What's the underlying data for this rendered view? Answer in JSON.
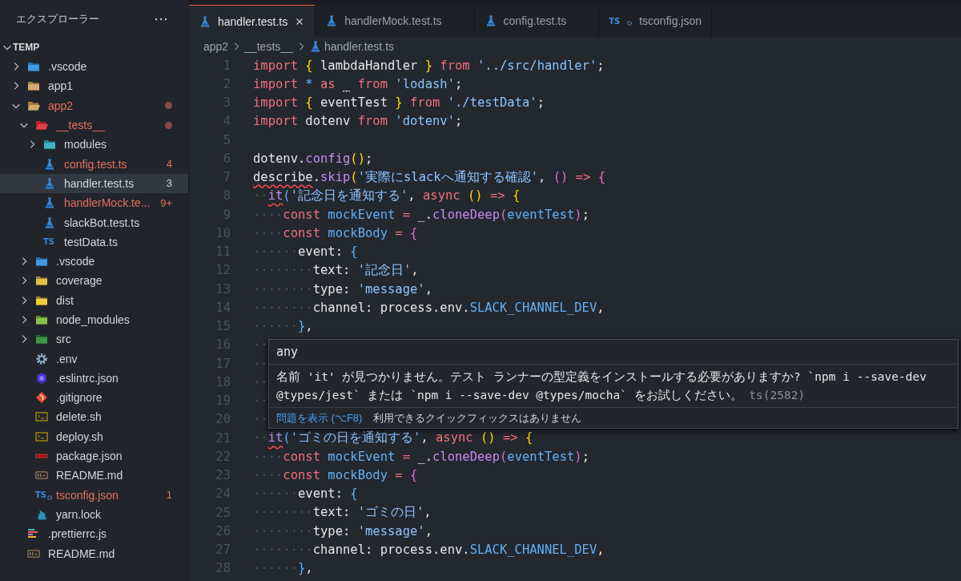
{
  "explorer": {
    "title": "エクスプローラー",
    "root": {
      "name": "TEMP",
      "expanded": true,
      "children": [
        {
          "name": ".vscode",
          "kind": "folder-vscode",
          "expanded": false,
          "error": false,
          "selected": false
        },
        {
          "name": "app1",
          "kind": "folder",
          "expanded": false,
          "error": false,
          "selected": false
        },
        {
          "name": "app2",
          "kind": "folder",
          "expanded": true,
          "error": true,
          "selected": false,
          "children": [
            {
              "name": "__tests__",
              "kind": "folder-test",
              "expanded": true,
              "error": true,
              "selected": false,
              "children": [
                {
                  "name": "modules",
                  "kind": "folder-modules",
                  "expanded": false,
                  "error": false,
                  "selected": false
                },
                {
                  "name": "config.test.ts",
                  "kind": "test-ts",
                  "error": true,
                  "badge": "4",
                  "selected": false
                },
                {
                  "name": "handler.test.ts",
                  "kind": "test-ts",
                  "error": false,
                  "badge": "3",
                  "selected": true
                },
                {
                  "name": "handlerMock.te...",
                  "kind": "test-ts",
                  "error": true,
                  "badge": "9+",
                  "selected": false
                },
                {
                  "name": "slackBot.test.ts",
                  "kind": "test-ts",
                  "error": false,
                  "selected": false
                },
                {
                  "name": "testData.ts",
                  "kind": "ts",
                  "icon_text": "TS",
                  "error": false,
                  "selected": false
                }
              ]
            },
            {
              "name": ".vscode",
              "kind": "folder-vscode",
              "expanded": false,
              "error": false,
              "selected": false
            },
            {
              "name": "coverage",
              "kind": "folder-coverage",
              "expanded": false,
              "error": false,
              "selected": false
            },
            {
              "name": "dist",
              "kind": "folder-dist",
              "expanded": false,
              "error": false,
              "selected": false
            },
            {
              "name": "node_modules",
              "kind": "folder-node",
              "expanded": false,
              "error": false,
              "selected": false
            },
            {
              "name": "src",
              "kind": "folder-src",
              "expanded": false,
              "error": false,
              "selected": false
            },
            {
              "name": ".env",
              "kind": "env",
              "error": false,
              "selected": false
            },
            {
              "name": ".eslintrc.json",
              "kind": "eslint",
              "error": false,
              "selected": false
            },
            {
              "name": ".gitignore",
              "kind": "git",
              "error": false,
              "selected": false
            },
            {
              "name": "delete.sh",
              "kind": "shell",
              "error": false,
              "selected": false
            },
            {
              "name": "deploy.sh",
              "kind": "shell",
              "error": false,
              "selected": false
            },
            {
              "name": "package.json",
              "kind": "npm",
              "error": false,
              "selected": false
            },
            {
              "name": "README.md",
              "kind": "markdown",
              "error": false,
              "selected": false
            },
            {
              "name": "tsconfig.json",
              "kind": "tsconfig",
              "icon_text": "TS",
              "error": true,
              "badge": "1",
              "selected": false
            },
            {
              "name": "yarn.lock",
              "kind": "yarn",
              "error": false,
              "selected": false
            }
          ]
        },
        {
          "name": ".prettierrc.js",
          "kind": "prettier",
          "error": false,
          "selected": false
        },
        {
          "name": "README.md",
          "kind": "markdown",
          "error": false,
          "selected": false
        }
      ]
    }
  },
  "tabs": [
    {
      "label": "handler.test.ts",
      "kind": "test-ts",
      "selected": true
    },
    {
      "label": "handlerMock.test.ts",
      "kind": "test-ts",
      "selected": false
    },
    {
      "label": "config.test.ts",
      "kind": "test-ts",
      "selected": false
    },
    {
      "label": "tsconfig.json",
      "kind": "tsconfig",
      "icon_text": "TS",
      "selected": false
    }
  ],
  "breadcrumb": [
    {
      "label": "app2",
      "kind": "folder"
    },
    {
      "label": "__tests__",
      "kind": "folder"
    },
    {
      "label": "handler.test.ts",
      "kind": "test-ts"
    }
  ],
  "code_lines": [
    {
      "number": "1",
      "tokens": [
        {
          "kind": "kw",
          "text": "import "
        },
        {
          "kind": "b1",
          "text": "{"
        },
        {
          "kind": "tx",
          "text": " lambdaHandler "
        },
        {
          "kind": "b1",
          "text": "}"
        },
        {
          "kind": "kw",
          "text": " from "
        },
        {
          "kind": "str",
          "text": "'../src/handler'"
        },
        {
          "kind": "tx",
          "text": ";"
        }
      ]
    },
    {
      "number": "2",
      "tokens": [
        {
          "kind": "kw",
          "text": "import "
        },
        {
          "kind": "op",
          "text": "* "
        },
        {
          "kind": "kw",
          "text": "as "
        },
        {
          "kind": "hinttx",
          "text": "_"
        },
        {
          "kind": "kw",
          "text": " from "
        },
        {
          "kind": "str",
          "text": "'lodash'"
        },
        {
          "kind": "tx",
          "text": ";"
        }
      ]
    },
    {
      "number": "3",
      "tokens": [
        {
          "kind": "kw",
          "text": "import "
        },
        {
          "kind": "b1",
          "text": "{"
        },
        {
          "kind": "tx",
          "text": " eventTest "
        },
        {
          "kind": "b1",
          "text": "}"
        },
        {
          "kind": "kw",
          "text": " from "
        },
        {
          "kind": "str",
          "text": "'./testData'"
        },
        {
          "kind": "tx",
          "text": ";"
        }
      ]
    },
    {
      "number": "4",
      "tokens": [
        {
          "kind": "kw",
          "text": "import "
        },
        {
          "kind": "tx",
          "text": "dotenv "
        },
        {
          "kind": "kw",
          "text": "from "
        },
        {
          "kind": "str",
          "text": "'dotenv'"
        },
        {
          "kind": "tx",
          "text": ";"
        }
      ]
    },
    {
      "number": "5"
    },
    {
      "number": "6",
      "tokens": [
        {
          "kind": "tx",
          "text": "dotenv."
        },
        {
          "kind": "fn",
          "text": "config"
        },
        {
          "kind": "b1",
          "text": "()"
        },
        {
          "kind": "tx",
          "text": ";"
        }
      ]
    },
    {
      "number": "7",
      "tokens": [
        {
          "kind": "errtx",
          "text": "describe"
        },
        {
          "kind": "tx",
          "text": "."
        },
        {
          "kind": "fn",
          "text": "skip"
        },
        {
          "kind": "b1",
          "text": "("
        },
        {
          "kind": "str",
          "text": "'実際にslackへ通知する確認'"
        },
        {
          "kind": "tx",
          "text": ", "
        },
        {
          "kind": "b2",
          "text": "() "
        },
        {
          "kind": "kw",
          "text": "=> "
        },
        {
          "kind": "b2",
          "text": "{"
        }
      ]
    },
    {
      "number": "8",
      "tokens": [
        {
          "kind": "ws",
          "text": "··"
        },
        {
          "kind": "errfn",
          "text": "it"
        },
        {
          "kind": "b3",
          "text": "("
        },
        {
          "kind": "str",
          "text": "'記念日を通知する'"
        },
        {
          "kind": "tx",
          "text": ", "
        },
        {
          "kind": "kw",
          "text": "async "
        },
        {
          "kind": "b1",
          "text": "() "
        },
        {
          "kind": "kw",
          "text": "=> "
        },
        {
          "kind": "b1",
          "text": "{"
        }
      ]
    },
    {
      "number": "9",
      "tokens": [
        {
          "kind": "ws",
          "text": "····"
        },
        {
          "kind": "kw",
          "text": "const "
        },
        {
          "kind": "var",
          "text": "mockEvent "
        },
        {
          "kind": "kw",
          "text": "= "
        },
        {
          "kind": "tx",
          "text": "_."
        },
        {
          "kind": "fn",
          "text": "cloneDeep"
        },
        {
          "kind": "b2",
          "text": "("
        },
        {
          "kind": "var",
          "text": "eventTest"
        },
        {
          "kind": "b2",
          "text": ")"
        },
        {
          "kind": "tx",
          "text": ";"
        }
      ]
    },
    {
      "number": "10",
      "tokens": [
        {
          "kind": "ws",
          "text": "····"
        },
        {
          "kind": "kw",
          "text": "const "
        },
        {
          "kind": "var",
          "text": "mockBody "
        },
        {
          "kind": "kw",
          "text": "= "
        },
        {
          "kind": "b2",
          "text": "{"
        }
      ]
    },
    {
      "number": "11",
      "tokens": [
        {
          "kind": "ws",
          "text": "······"
        },
        {
          "kind": "tx",
          "text": "event: "
        },
        {
          "kind": "b3",
          "text": "{"
        }
      ]
    },
    {
      "number": "12",
      "tokens": [
        {
          "kind": "ws",
          "text": "········"
        },
        {
          "kind": "tx",
          "text": "text: "
        },
        {
          "kind": "str",
          "text": "'記念日'"
        },
        {
          "kind": "tx",
          "text": ","
        }
      ]
    },
    {
      "number": "13",
      "tokens": [
        {
          "kind": "ws",
          "text": "········"
        },
        {
          "kind": "tx",
          "text": "type: "
        },
        {
          "kind": "str",
          "text": "'message'"
        },
        {
          "kind": "tx",
          "text": ","
        }
      ]
    },
    {
      "number": "14",
      "tokens": [
        {
          "kind": "ws",
          "text": "········"
        },
        {
          "kind": "tx",
          "text": "channel: process.env."
        },
        {
          "kind": "var",
          "text": "SLACK_CHANNEL_DEV"
        },
        {
          "kind": "tx",
          "text": ","
        }
      ]
    },
    {
      "number": "15",
      "tokens": [
        {
          "kind": "ws",
          "text": "······"
        },
        {
          "kind": "b3",
          "text": "}"
        },
        {
          "kind": "tx",
          "text": ","
        }
      ]
    },
    {
      "number": "16",
      "tokens": [
        {
          "kind": "ws",
          "text": "··"
        }
      ]
    },
    {
      "number": "17",
      "tokens": [
        {
          "kind": "ws",
          "text": "··"
        }
      ]
    },
    {
      "number": "18",
      "tokens": [
        {
          "kind": "ws",
          "text": "··"
        }
      ]
    },
    {
      "number": "19",
      "tokens": [
        {
          "kind": "ws",
          "text": "··"
        }
      ]
    },
    {
      "number": "20",
      "tokens": [
        {
          "kind": "ws",
          "text": "··"
        }
      ]
    },
    {
      "number": "21",
      "tokens": [
        {
          "kind": "ws",
          "text": "··"
        },
        {
          "kind": "errfn",
          "text": "it"
        },
        {
          "kind": "b3",
          "text": "("
        },
        {
          "kind": "str",
          "text": "'ゴミの日を通知する'"
        },
        {
          "kind": "tx",
          "text": ", "
        },
        {
          "kind": "kw",
          "text": "async "
        },
        {
          "kind": "b1",
          "text": "() "
        },
        {
          "kind": "kw",
          "text": "=> "
        },
        {
          "kind": "b1",
          "text": "{"
        }
      ]
    },
    {
      "number": "22",
      "tokens": [
        {
          "kind": "ws",
          "text": "····"
        },
        {
          "kind": "kw",
          "text": "const "
        },
        {
          "kind": "var",
          "text": "mockEvent "
        },
        {
          "kind": "kw",
          "text": "= "
        },
        {
          "kind": "tx",
          "text": "_."
        },
        {
          "kind": "fn",
          "text": "cloneDeep"
        },
        {
          "kind": "b2",
          "text": "("
        },
        {
          "kind": "var",
          "text": "eventTest"
        },
        {
          "kind": "b2",
          "text": ")"
        },
        {
          "kind": "tx",
          "text": ";"
        }
      ]
    },
    {
      "number": "23",
      "tokens": [
        {
          "kind": "ws",
          "text": "····"
        },
        {
          "kind": "kw",
          "text": "const "
        },
        {
          "kind": "var",
          "text": "mockBody "
        },
        {
          "kind": "kw",
          "text": "= "
        },
        {
          "kind": "b2",
          "text": "{"
        }
      ]
    },
    {
      "number": "24",
      "tokens": [
        {
          "kind": "ws",
          "text": "······"
        },
        {
          "kind": "tx",
          "text": "event: "
        },
        {
          "kind": "b3",
          "text": "{"
        }
      ]
    },
    {
      "number": "25",
      "tokens": [
        {
          "kind": "ws",
          "text": "········"
        },
        {
          "kind": "tx",
          "text": "text: "
        },
        {
          "kind": "str",
          "text": "'ゴミの日'"
        },
        {
          "kind": "tx",
          "text": ","
        }
      ]
    },
    {
      "number": "26",
      "tokens": [
        {
          "kind": "ws",
          "text": "········"
        },
        {
          "kind": "tx",
          "text": "type: "
        },
        {
          "kind": "str",
          "text": "'message'"
        },
        {
          "kind": "tx",
          "text": ","
        }
      ]
    },
    {
      "number": "27",
      "tokens": [
        {
          "kind": "ws",
          "text": "········"
        },
        {
          "kind": "tx",
          "text": "channel: process.env."
        },
        {
          "kind": "var",
          "text": "SLACK_CHANNEL_DEV"
        },
        {
          "kind": "tx",
          "text": ","
        }
      ]
    },
    {
      "number": "28",
      "tokens": [
        {
          "kind": "ws",
          "text": "······"
        },
        {
          "kind": "b3",
          "text": "}"
        },
        {
          "kind": "tx",
          "text": ","
        }
      ]
    }
  ],
  "hover": {
    "type": "any",
    "message": "名前 'it' が見つかりません。テスト ランナーの型定義をインストールする必要がありますか? `npm i --save-dev @types/jest` または `npm i --save-dev @types/mocha` をお試しください。",
    "code": "ts(2582)",
    "link": "問題を表示 (⌥F8)",
    "note": "利用できるクイックフィックスはありません"
  }
}
